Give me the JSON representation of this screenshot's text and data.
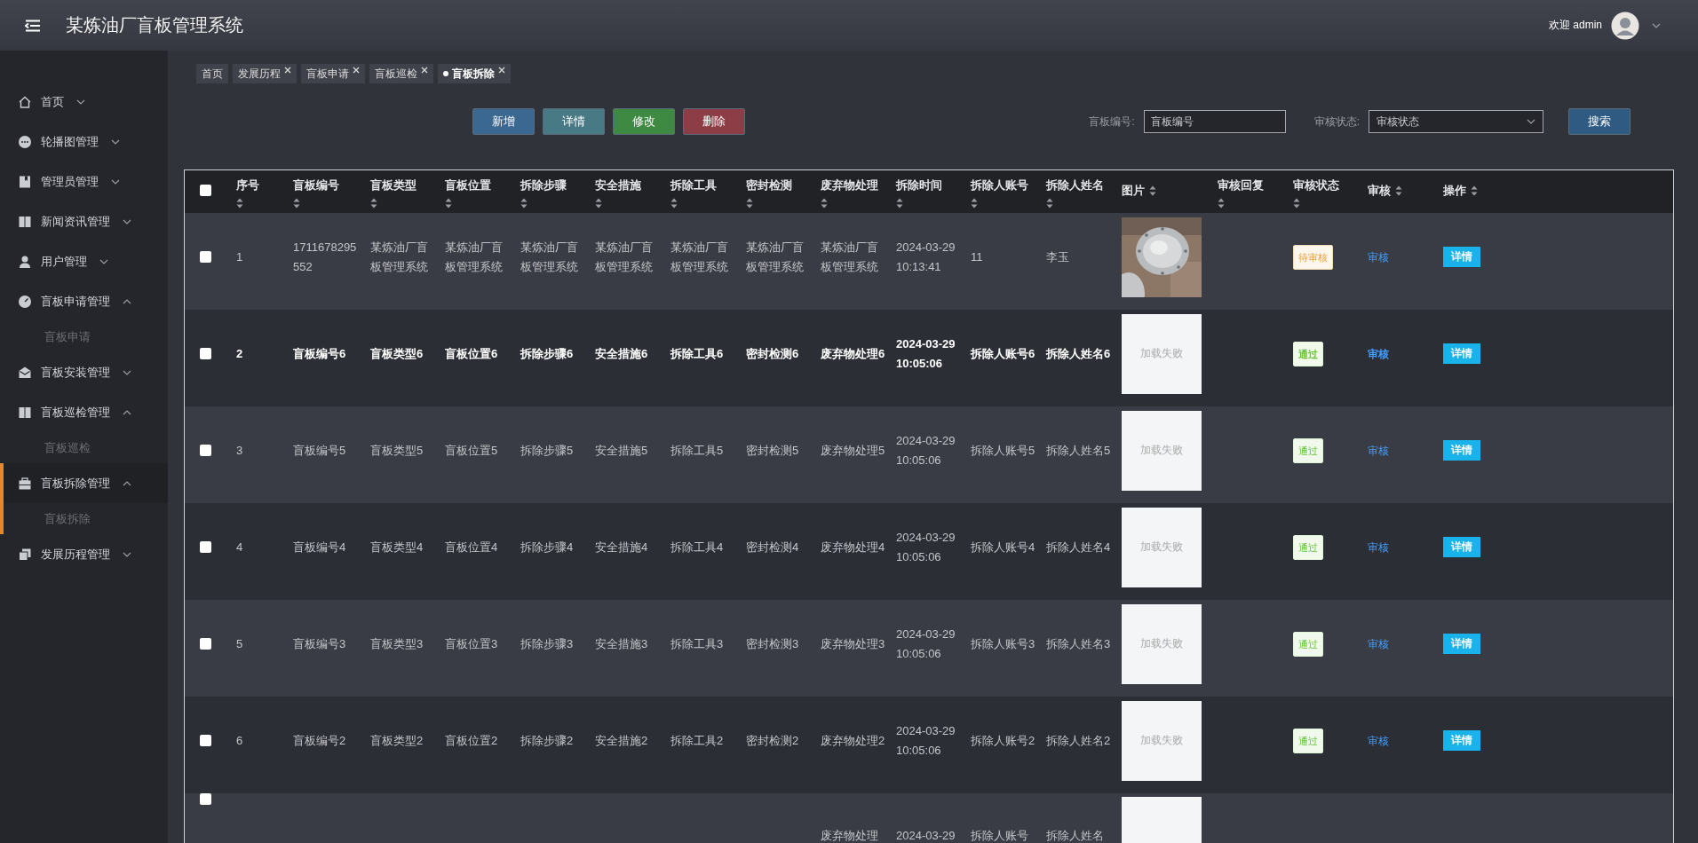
{
  "header": {
    "title": "某炼油厂盲板管理系统",
    "welcome": "欢迎 admin"
  },
  "sidebar": {
    "items": [
      {
        "label": "首页",
        "expanded": false,
        "selected": false
      },
      {
        "label": "轮播图管理",
        "expanded": false,
        "selected": false
      },
      {
        "label": "管理员管理",
        "expanded": false,
        "selected": false
      },
      {
        "label": "新闻资讯管理",
        "expanded": false,
        "selected": false
      },
      {
        "label": "用户管理",
        "expanded": false,
        "selected": false
      },
      {
        "label": "盲板申请管理",
        "expanded": true,
        "selected": false,
        "children": [
          {
            "label": "盲板申请"
          }
        ]
      },
      {
        "label": "盲板安装管理",
        "expanded": false,
        "selected": false
      },
      {
        "label": "盲板巡检管理",
        "expanded": true,
        "selected": false,
        "children": [
          {
            "label": "盲板巡检"
          }
        ]
      },
      {
        "label": "盲板拆除管理",
        "expanded": true,
        "selected": true,
        "children": [
          {
            "label": "盲板拆除"
          }
        ]
      },
      {
        "label": "发展历程管理",
        "expanded": false,
        "selected": false
      }
    ]
  },
  "tabs": [
    {
      "label": "首页",
      "closable": false,
      "selected": false
    },
    {
      "label": "发展历程",
      "closable": true,
      "selected": false
    },
    {
      "label": "盲板申请",
      "closable": true,
      "selected": false
    },
    {
      "label": "盲板巡检",
      "closable": true,
      "selected": false
    },
    {
      "label": "盲板拆除",
      "closable": true,
      "selected": true
    }
  ],
  "toolbar": {
    "buttons": [
      {
        "label": "新增",
        "kind": "add"
      },
      {
        "label": "详情",
        "kind": "detail"
      },
      {
        "label": "修改",
        "kind": "edit"
      },
      {
        "label": "删除",
        "kind": "delete"
      }
    ],
    "search": {
      "code_label": "盲板编号:",
      "code_placeholder": "盲板编号",
      "status_label": "审核状态:",
      "status_placeholder": "审核状态",
      "button": "搜索"
    }
  },
  "table": {
    "all_checked": false,
    "columns": [
      "序号",
      "盲板编号",
      "盲板类型",
      "盲板位置",
      "拆除步骤",
      "安全措施",
      "拆除工具",
      "密封检测",
      "废弃物处理",
      "拆除时间",
      "拆除人账号",
      "拆除人姓名",
      "图片",
      "审核回复",
      "审核状态",
      "审核",
      "操作"
    ],
    "rows": [
      {
        "kind": "full",
        "checked": false,
        "selected": false,
        "no": "1",
        "code": "1711678295552",
        "type": "某炼油厂盲板管理系统",
        "location": "某炼油厂盲板管理系统",
        "steps": "某炼油厂盲板管理系统",
        "safety": "某炼油厂盲板管理系统",
        "tool": "某炼油厂盲板管理系统",
        "seal": "某炼油厂盲板管理系统",
        "waste": "某炼油厂盲板管理系统",
        "time": "2024-03-29 10:13:41",
        "account": "11",
        "name": "李玉",
        "status": {
          "label": "待审核",
          "kind": "pending"
        },
        "review": "审核",
        "action": "详情"
      },
      {
        "kind": "full",
        "checked": false,
        "selected": true,
        "no": "2",
        "code": "盲板编号6",
        "type": "盲板类型6",
        "location": "盲板位置6",
        "steps": "拆除步骤6",
        "safety": "安全措施6",
        "tool": "拆除工具6",
        "seal": "密封检测6",
        "waste": "废弃物处理6",
        "time": "2024-03-29 10:05:06",
        "account": "拆除人账号6",
        "name": "拆除人姓名6",
        "image": {
          "kind": "failed",
          "text": "加载失败"
        },
        "status": {
          "label": "通过",
          "kind": "approved"
        },
        "review": "审核",
        "action": "详情"
      },
      {
        "kind": "full",
        "checked": false,
        "selected": false,
        "no": "3",
        "code": "盲板编号5",
        "type": "盲板类型5",
        "location": "盲板位置5",
        "steps": "拆除步骤5",
        "safety": "安全措施5",
        "tool": "拆除工具5",
        "seal": "密封检测5",
        "waste": "废弃物处理5",
        "time": "2024-03-29 10:05:06",
        "account": "拆除人账号5",
        "name": "拆除人姓名5",
        "image": {
          "kind": "failed",
          "text": "加载失败"
        },
        "status": {
          "label": "通过",
          "kind": "approved"
        },
        "review": "审核",
        "action": "详情"
      },
      {
        "kind": "full",
        "checked": false,
        "selected": false,
        "no": "4",
        "code": "盲板编号4",
        "type": "盲板类型4",
        "location": "盲板位置4",
        "steps": "拆除步骤4",
        "safety": "安全措施4",
        "tool": "拆除工具4",
        "seal": "密封检测4",
        "waste": "废弃物处理4",
        "time": "2024-03-29 10:05:06",
        "account": "拆除人账号4",
        "name": "拆除人姓名4",
        "image": {
          "kind": "failed",
          "text": "加载失败"
        },
        "status": {
          "label": "通过",
          "kind": "approved"
        },
        "review": "审核",
        "action": "详情"
      },
      {
        "kind": "full",
        "checked": false,
        "selected": false,
        "no": "5",
        "code": "盲板编号3",
        "type": "盲板类型3",
        "location": "盲板位置3",
        "steps": "拆除步骤3",
        "safety": "安全措施3",
        "tool": "拆除工具3",
        "seal": "密封检测3",
        "waste": "废弃物处理3",
        "time": "2024-03-29 10:05:06",
        "account": "拆除人账号3",
        "name": "拆除人姓名3",
        "image": {
          "kind": "failed",
          "text": "加载失败"
        },
        "status": {
          "label": "通过",
          "kind": "approved"
        },
        "review": "审核",
        "action": "详情"
      },
      {
        "kind": "full",
        "checked": false,
        "selected": false,
        "no": "6",
        "code": "盲板编号2",
        "type": "盲板类型2",
        "location": "盲板位置2",
        "steps": "拆除步骤2",
        "safety": "安全措施2",
        "tool": "拆除工具2",
        "seal": "密封检测2",
        "waste": "废弃物处理2",
        "time": "2024-03-29 10:05:06",
        "account": "拆除人账号2",
        "name": "拆除人姓名2",
        "image": {
          "kind": "failed",
          "text": "加载失败"
        },
        "status": {
          "label": "通过",
          "kind": "approved"
        },
        "review": "审核",
        "action": "详情"
      },
      {
        "kind": "partial",
        "checked": false,
        "selected": false,
        "waste": "废弃物处理",
        "time": "2024-03-29",
        "account": "拆除人账号",
        "name": "拆除人姓名",
        "image": {
          "kind": "failed"
        }
      }
    ]
  }
}
